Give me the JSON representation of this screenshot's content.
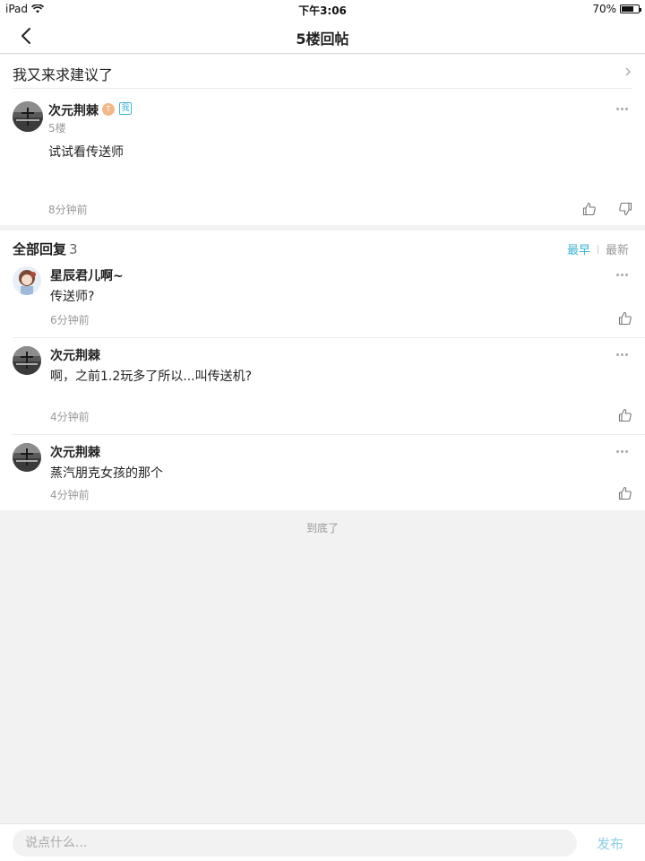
{
  "status_bar": {
    "device": "iPad",
    "time": "下午3:06",
    "battery": "70%",
    "battery_level": 0.7
  },
  "nav": {
    "title": "5楼回帖"
  },
  "thread": {
    "title": "我又来求建议了"
  },
  "main_post": {
    "username": "次元荆棘",
    "level_badge": "T",
    "me_badge": "我",
    "floor": "5楼",
    "content": "试试看传送师",
    "time": "8分钟前"
  },
  "replies_section": {
    "label": "全部回复",
    "count": "3",
    "sort_earliest": "最早",
    "sort_latest": "最新",
    "items": [
      {
        "username": "星辰君儿啊~",
        "text": "传送师?",
        "time": "6分钟前"
      },
      {
        "username": "次元荆棘",
        "text": "啊，之前1.2玩多了所以...叫传送机?",
        "time": "4分钟前"
      },
      {
        "username": "次元荆棘",
        "text": "蒸汽朋克女孩的那个",
        "time": "4分钟前"
      }
    ]
  },
  "footer_note": "到底了",
  "composer": {
    "placeholder": "说点什么...",
    "send_label": "发布"
  },
  "colors": {
    "accent": "#3fb4d6",
    "send_disabled": "#8ccfe6",
    "background": "#f2f2f2"
  }
}
